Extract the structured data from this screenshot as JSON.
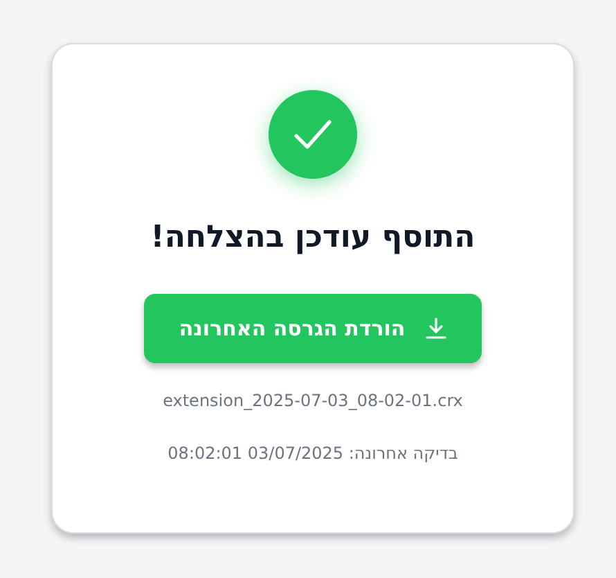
{
  "status": {
    "kind": "success"
  },
  "title": "התוסף עודכן בהצלחה!",
  "download_button": {
    "label": "הורדת הגרסה האחרונה"
  },
  "filename": "extension_2025-07-03_08-02-01.crx",
  "last_check": "בדיקה אחרונה: 03/07/2025 08:02:01"
}
